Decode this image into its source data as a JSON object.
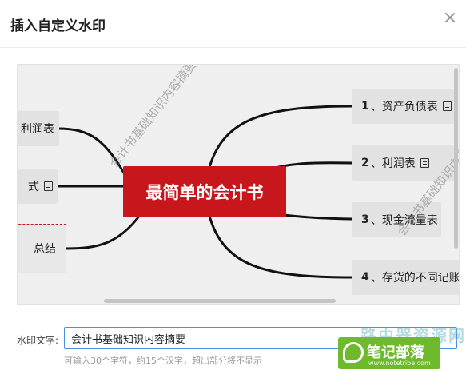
{
  "dialog": {
    "title": "插入自定义水印"
  },
  "mindmap": {
    "center_label": "最简单的会计书",
    "right_nodes": [
      {
        "num": "1",
        "label": "、资产负债表",
        "has_note": true
      },
      {
        "num": "2",
        "label": "、利润表",
        "has_note": true
      },
      {
        "num": "3",
        "label": "、现金流量表",
        "has_note": false
      },
      {
        "num": "4",
        "label": "、存货的不同记账",
        "has_note": false
      }
    ],
    "left_nodes": [
      {
        "label": "利润表",
        "has_note": false
      },
      {
        "label": "式",
        "has_note": true
      }
    ],
    "summary_label": "总结",
    "watermark_text": "会计书基础知识内容摘要"
  },
  "form": {
    "label": "水印文字:",
    "value": "会计书基础知识内容摘要",
    "hint": "可输入30个字符，约15个汉字，超出部分将不显示"
  },
  "site_logo": {
    "top_text": "路由器资源网",
    "main_text": "笔记部落",
    "url_text": "www.notetribe.com"
  },
  "colors": {
    "center_node": "#c8161d",
    "input_border": "#4a90e2",
    "logo_green": "#6fba2c"
  }
}
